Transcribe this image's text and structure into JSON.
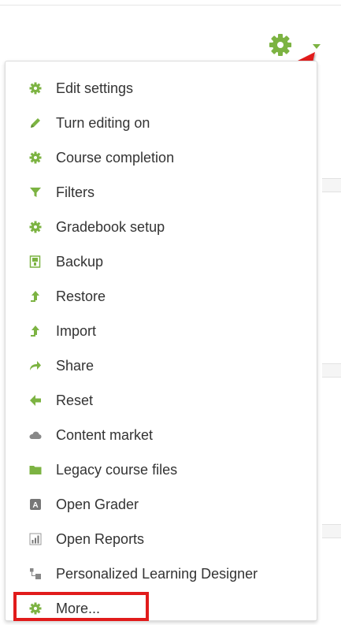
{
  "colors": {
    "accent": "#7cb342",
    "annotation": "#e11b1b",
    "icon_gray": "#777777"
  },
  "menu": {
    "items": [
      {
        "label": "Edit settings",
        "icon": "gear-icon"
      },
      {
        "label": "Turn editing on",
        "icon": "pencil-icon"
      },
      {
        "label": "Course completion",
        "icon": "gear-icon"
      },
      {
        "label": "Filters",
        "icon": "filter-icon"
      },
      {
        "label": "Gradebook setup",
        "icon": "gear-icon"
      },
      {
        "label": "Backup",
        "icon": "backup-file-icon"
      },
      {
        "label": "Restore",
        "icon": "upload-arrow-icon"
      },
      {
        "label": "Import",
        "icon": "upload-arrow-icon"
      },
      {
        "label": "Share",
        "icon": "share-arrow-icon"
      },
      {
        "label": "Reset",
        "icon": "back-arrow-icon"
      },
      {
        "label": "Content market",
        "icon": "cloud-icon"
      },
      {
        "label": "Legacy course files",
        "icon": "folder-icon"
      },
      {
        "label": "Open Grader",
        "icon": "grader-icon"
      },
      {
        "label": "Open Reports",
        "icon": "bar-chart-icon"
      },
      {
        "label": "Personalized Learning Designer",
        "icon": "designer-icon"
      },
      {
        "label": "More...",
        "icon": "gear-icon"
      }
    ]
  }
}
